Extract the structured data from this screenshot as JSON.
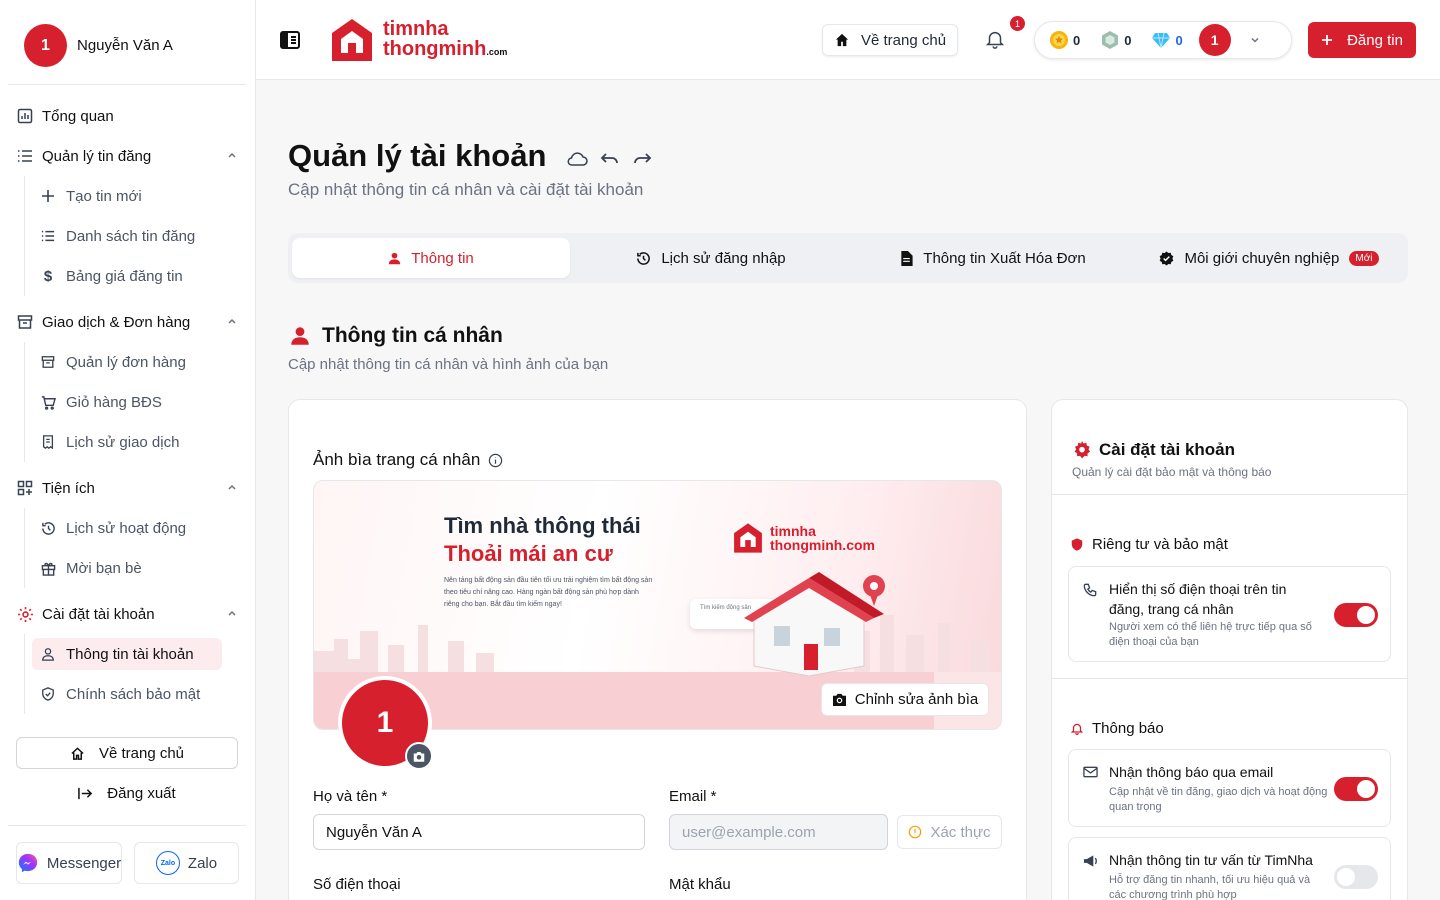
{
  "user": {
    "avatar_initial": "1",
    "name": "Nguyễn Văn A"
  },
  "sidebar": {
    "overview": "Tổng quan",
    "listings": {
      "label": "Quản lý tin đăng",
      "items": [
        "Tạo tin mới",
        "Danh sách tin đăng",
        "Bảng giá đăng tin"
      ]
    },
    "orders": {
      "label": "Giao dịch & Đơn hàng",
      "items": [
        "Quản lý đơn hàng",
        "Giỏ hàng BĐS",
        "Lịch sử giao dịch"
      ]
    },
    "utilities": {
      "label": "Tiện ích",
      "items": [
        "Lịch sử hoạt động",
        "Mời bạn bè"
      ]
    },
    "account": {
      "label": "Cài đặt tài khoản",
      "items": [
        "Thông tin tài khoản",
        "Chính sách bảo mật"
      ]
    },
    "home_button": "Về trang chủ",
    "logout_button": "Đăng xuất",
    "messenger": "Messenger",
    "zalo": "Zalo",
    "zalo_logo_text": "Zalo"
  },
  "header": {
    "logo_line1": "timnha",
    "logo_line2": "thongminh",
    "logo_suffix": ".com",
    "home_button": "Về trang chủ",
    "notification_count": "1",
    "wallet": {
      "gold": "0",
      "green": "0",
      "diamond": "0"
    },
    "avatar_initial": "1",
    "post_button": "Đăng tin"
  },
  "page": {
    "title": "Quản lý tài khoản",
    "subtitle": "Cập nhật thông tin cá nhân và cài đặt tài khoản",
    "tabs": [
      "Thông tin",
      "Lịch sử đăng nhập",
      "Thông tin Xuất Hóa Đơn",
      "Môi giới chuyên nghiệp"
    ],
    "tab_badge": "Mới",
    "section_title": "Thông tin cá nhân",
    "section_subtitle": "Cập nhật thông tin cá nhân và hình ảnh của bạn"
  },
  "profile": {
    "cover_label": "Ảnh bìa trang cá nhân",
    "cover_headline1": "Tìm nhà thông thái",
    "cover_headline2": "Thoải mái an cư",
    "cover_text": "Nên tảng bất động sản đầu tiên tối ưu trải nghiệm tìm bất động sản theo tiêu chí nâng cao. Hàng ngàn bất động sản phù hợp dành riêng cho bạn. Bắt đầu tìm kiếm ngay!",
    "cover_logo_line1": "timnha",
    "cover_logo_line2": "thongminh.com",
    "cover_search_hint": "Tìm kiếm động sản",
    "edit_cover": "Chỉnh sửa ảnh bìa",
    "avatar_initial": "1",
    "name_label": "Họ và tên *",
    "name_value": "Nguyễn Văn A",
    "email_label": "Email *",
    "email_placeholder": "user@example.com",
    "verify": "Xác thực",
    "phone_label": "Số điện thoại",
    "password_label": "Mật khẩu"
  },
  "settings": {
    "title": "Cài đặt tài khoản",
    "subtitle": "Quản lý cài đặt bảo mật và thông báo",
    "privacy_title": "Riêng tư và bảo mật",
    "privacy_options": [
      {
        "title": "Hiển thị số điện thoại trên tin đăng, trang cá nhân",
        "desc": "Người xem có thể liên hệ trực tiếp qua số điện thoại của bạn",
        "enabled": true
      }
    ],
    "notify_title": "Thông báo",
    "notify_options": [
      {
        "title": "Nhận thông báo qua email",
        "desc": "Cập nhật về tin đăng, giao dịch và hoạt động quan trọng",
        "enabled": true
      },
      {
        "title": "Nhận thông tin tư vấn từ TimNha",
        "desc": "Hỗ trợ đăng tin nhanh, tối ưu hiệu quả và các chương trình phù hợp",
        "enabled": false
      }
    ]
  },
  "colors": {
    "brand": "#d7202e",
    "bg": "#f7f7f8"
  }
}
